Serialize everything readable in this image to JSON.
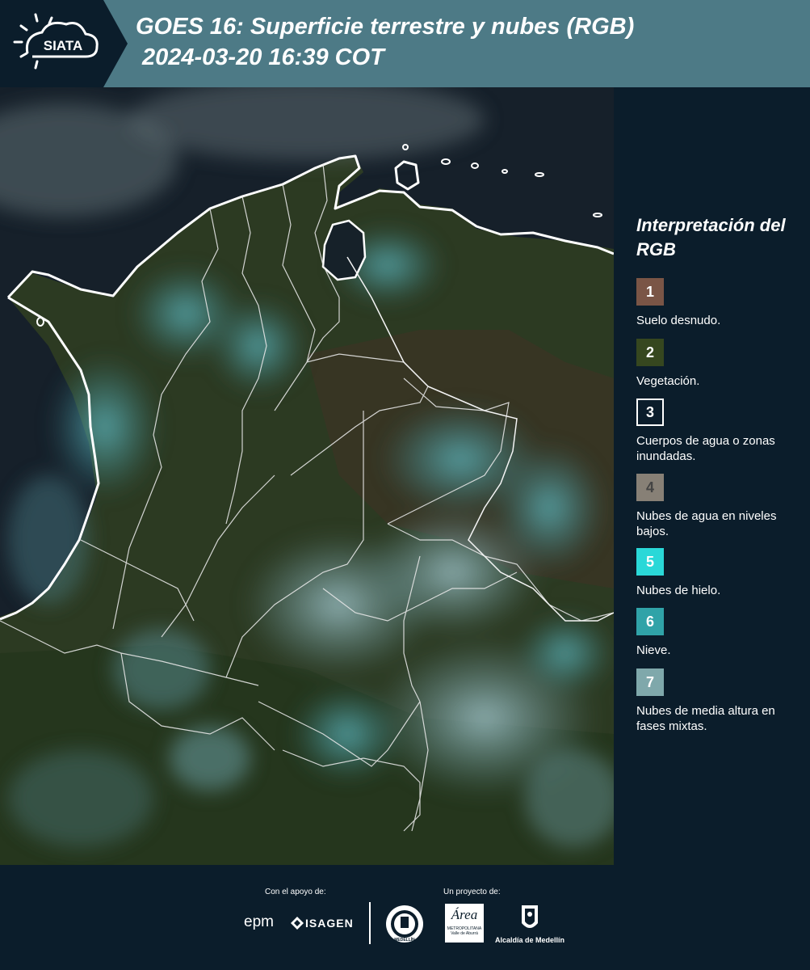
{
  "header": {
    "logo_text": "SIATA",
    "title_line1": "GOES 16: Superficie terrestre y nubes (RGB)",
    "title_line2": "2024-03-20 16:39 COT",
    "background_color": "#4d7a86",
    "logo_background_color": "#0b1d2b"
  },
  "legend": {
    "title": "Interpretación del RGB",
    "items": [
      {
        "number": "1",
        "label": "Suelo desnudo.",
        "color": "#7a5546"
      },
      {
        "number": "2",
        "label": "Vegetación.",
        "color": "#36471f"
      },
      {
        "number": "3",
        "label": "Cuerpos de agua o zonas inundadas.",
        "color": "#0b1d2b"
      },
      {
        "number": "4",
        "label": "Nubes de agua en niveles bajos.",
        "color": "#878076"
      },
      {
        "number": "5",
        "label": "Nubes de hielo.",
        "color": "#2ad8d8"
      },
      {
        "number": "6",
        "label": "Nieve.",
        "color": "#30a3a8"
      },
      {
        "number": "7",
        "label": "Nubes de media altura en fases mixtas.",
        "color": "#7fa8ab"
      }
    ]
  },
  "footer": {
    "support_label": "Con el apoyo de:",
    "project_label": "Un proyecto de:",
    "sponsor_epm": "epm",
    "sponsor_isagen": "ISAGEN",
    "area_metropolitana_name": "Área",
    "area_metropolitana_caption": "METROPOLITANA Valle de Aburrá",
    "alcaldia_name": "Alcaldía de Medellín",
    "seal_caption": "MEDELLÍN"
  }
}
